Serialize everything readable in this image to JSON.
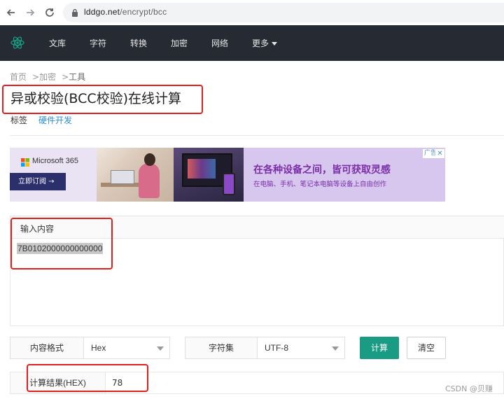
{
  "browser": {
    "url_host": "lddgo.net",
    "url_path": "/encrypt/bcc"
  },
  "nav": {
    "items": [
      "文库",
      "字符",
      "转换",
      "加密",
      "网络"
    ],
    "more": "更多"
  },
  "breadcrumb": {
    "items": [
      "首页",
      "加密",
      "工具"
    ],
    "separator": ">"
  },
  "page": {
    "title": "异或校验(BCC校验)在线计算",
    "tags_label": "标签",
    "tag": "硬件开发"
  },
  "ad": {
    "brand": "Microsoft 365",
    "cta": "立即订阅 →",
    "headline": "在各种设备之间，皆可获取灵感",
    "subline": "在电脑、手机、笔记本电脑等设备上自由创作",
    "badge": "广告",
    "close": "✕"
  },
  "input": {
    "label": "输入内容",
    "value": "7B0102000000000000"
  },
  "options": {
    "format_label": "内容格式",
    "format_value": "Hex",
    "charset_label": "字符集",
    "charset_value": "UTF-8"
  },
  "buttons": {
    "calculate": "计算",
    "clear": "清空"
  },
  "result": {
    "label": "计算结果(HEX)",
    "value": "78"
  },
  "watermark": "CSDN @贝赚",
  "colors": {
    "nav_bg": "#252a33",
    "accent": "#1a9b84",
    "highlight": "#e02020",
    "link": "#2a8fd6"
  }
}
